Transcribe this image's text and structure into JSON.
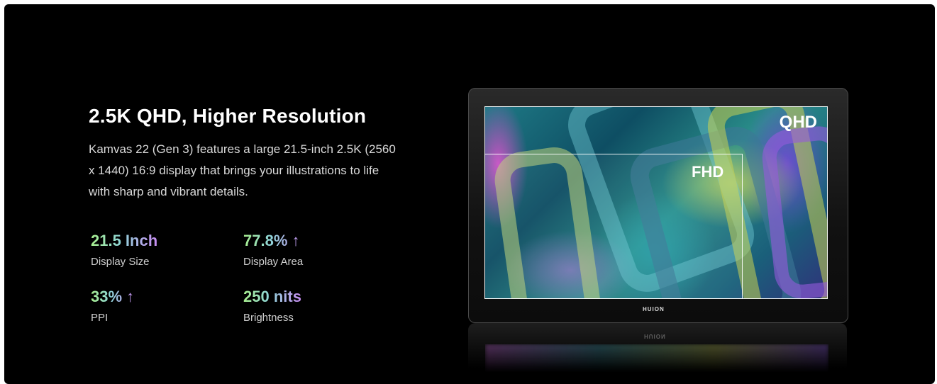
{
  "heading": "2.5K QHD, Higher Resolution",
  "description": "Kamvas 22 (Gen 3) features a large 21.5-inch 2.5K (2560 x 1440) 16:9 display that brings your illustrations to life with sharp and vibrant details.",
  "stats": [
    {
      "value": "21.5 Inch",
      "label": "Display Size"
    },
    {
      "value": "77.8% ↑",
      "label": "Display Area"
    },
    {
      "value": "33% ↑",
      "label": "PPI"
    },
    {
      "value": "250 nits",
      "label": "Brightness"
    }
  ],
  "monitor": {
    "qhd_label": "QHD",
    "fhd_label": "FHD",
    "brand": "HUION"
  },
  "colors": {
    "background": "#000000",
    "stat_gradient": [
      "#a8ef8e",
      "#8fd5d8",
      "#c88cf2"
    ]
  }
}
